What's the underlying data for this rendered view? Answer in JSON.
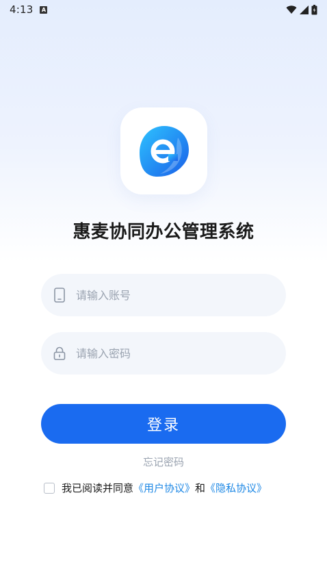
{
  "status_bar": {
    "time": "4:13",
    "notification_icon": "A"
  },
  "app": {
    "title": "惠麦协同办公管理系统"
  },
  "form": {
    "account_placeholder": "请输入账号",
    "password_placeholder": "请输入密码",
    "login_label": "登录",
    "forgot_label": "忘记密码"
  },
  "agreement": {
    "prefix": "我已阅读并同意",
    "user_agreement": "《用户协议》",
    "connector": "和",
    "privacy_policy": "《隐私协议》"
  },
  "colors": {
    "accent": "#1a6bf0",
    "link": "#1e88e5",
    "placeholder": "#9aa3b0",
    "field_bg": "#f3f6fb"
  }
}
